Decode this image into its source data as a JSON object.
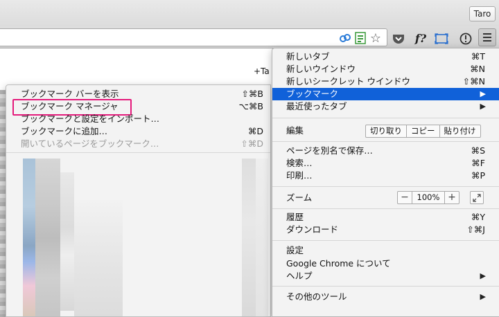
{
  "profile": {
    "name": "Taro"
  },
  "toolbar": {
    "icons": [
      "link-icon",
      "sheet-icon",
      "star-icon",
      "pocket-icon",
      "fquery-icon",
      "screen-icon",
      "info-icon",
      "hamburger-menu-icon"
    ],
    "fquery_text": "f?"
  },
  "page": {
    "tab_fragment": "+Ta"
  },
  "bookmarks_submenu": {
    "items": [
      {
        "label": "ブックマーク バーを表示",
        "shortcut": "⇧⌘B",
        "enabled": true
      },
      {
        "label": "ブックマーク マネージャ",
        "shortcut": "⌥⌘B",
        "enabled": true
      },
      {
        "label": "ブックマークと設定をインポート…",
        "shortcut": "",
        "enabled": true
      },
      {
        "label": "ブックマークに追加…",
        "shortcut": "⌘D",
        "enabled": true
      },
      {
        "label": "開いているページをブックマーク…",
        "shortcut": "⇧⌘D",
        "enabled": false
      }
    ],
    "highlight_color": "#e4197a"
  },
  "main_menu": {
    "items": [
      {
        "label": "新しいタブ",
        "shortcut": "⌘T"
      },
      {
        "label": "新しいウインドウ",
        "shortcut": "⌘N"
      },
      {
        "label": "新しいシークレット ウインドウ",
        "shortcut": "⇧⌘N"
      },
      {
        "label": "ブックマーク",
        "arrow": "▶"
      },
      {
        "label": "最近使ったタブ",
        "arrow": "▶"
      }
    ],
    "edit": {
      "label": "編集",
      "cut": "切り取り",
      "copy": "コピー",
      "paste": "貼り付け"
    },
    "items2": [
      {
        "label": "ページを別名で保存…",
        "shortcut": "⌘S"
      },
      {
        "label": "検索…",
        "shortcut": "⌘F"
      },
      {
        "label": "印刷…",
        "shortcut": "⌘P"
      }
    ],
    "zoom": {
      "label": "ズーム",
      "minus": "−",
      "value": "100%",
      "plus": "+"
    },
    "items3": [
      {
        "label": "履歴",
        "shortcut": "⌘Y"
      },
      {
        "label": "ダウンロード",
        "shortcut": "⇧⌘J"
      }
    ],
    "items4": [
      {
        "label": "設定"
      },
      {
        "label": "Google Chrome について"
      },
      {
        "label": "ヘルプ",
        "arrow": "▶"
      }
    ],
    "items5": [
      {
        "label": "その他のツール",
        "arrow": "▶"
      }
    ],
    "active_color": "#1061d9"
  }
}
